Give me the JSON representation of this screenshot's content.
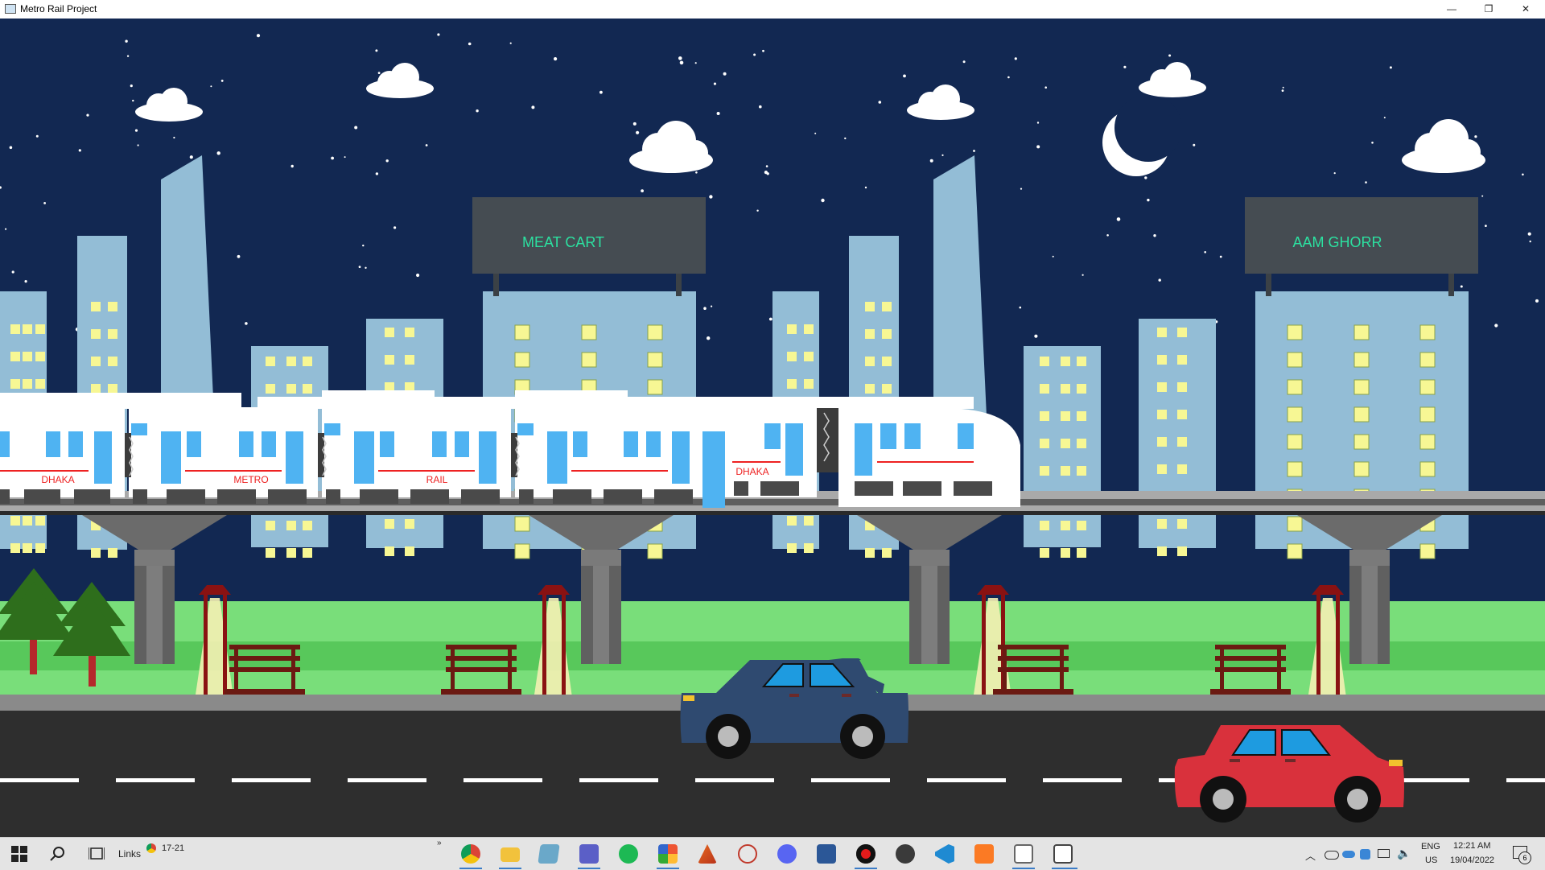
{
  "window": {
    "title": "Metro Rail Project",
    "controls": {
      "minimize": "—",
      "maximize": "❐",
      "close": "✕"
    }
  },
  "scene": {
    "billboards": [
      "MEAT CART",
      "AAM GHORR"
    ],
    "train_labels": [
      "DHAKA",
      "METRO",
      "RAIL",
      "DHAKA"
    ],
    "colors": {
      "sky": "#122852",
      "building": "#93bdd6",
      "window": "#f7f794",
      "grass_light": "#79de7a",
      "grass_dark": "#58c85b",
      "road": "#2e2e2e",
      "train_body": "#ffffff",
      "train_window": "#4fb3f2",
      "car_blue": "#2f4a70",
      "car_red": "#d9313c",
      "billboard_text": "#2ce0a0"
    }
  },
  "taskbar": {
    "links_label": "Links",
    "chrome_group_label": "17-21",
    "chevron": "»",
    "apps": [
      "chrome-icon",
      "file-explorer-icon",
      "notes-icon",
      "teams-icon",
      "spotify-icon",
      "office-icon",
      "matlab-icon",
      "snipping-tool-icon",
      "discord-icon",
      "word-icon",
      "record-icon",
      "obs-icon",
      "vscode-icon",
      "xampp-icon",
      "window-app-icon",
      "window-app-icon-2"
    ],
    "language": "ENG",
    "region": "US",
    "time": "12:21 AM",
    "date": "19/04/2022",
    "notifications": "6"
  }
}
